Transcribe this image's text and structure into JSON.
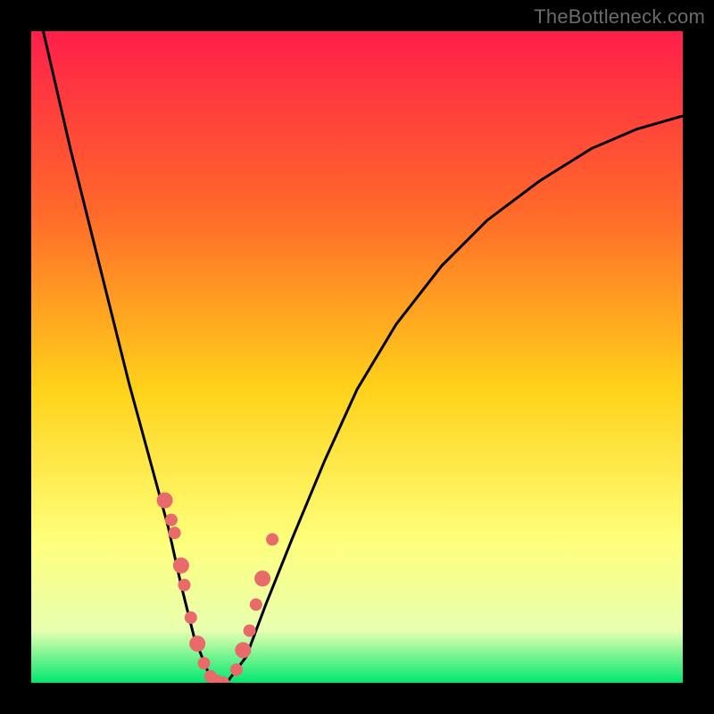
{
  "watermark": "TheBottleneck.com",
  "colors": {
    "frame": "#000000",
    "grad_top": "#ff1f4a",
    "grad_mid1": "#ff6a2a",
    "grad_mid2": "#ffd21a",
    "grad_mid3": "#ffff7a",
    "grad_mid4": "#e8ffb0",
    "grad_bottom": "#00e870",
    "curve": "#000000",
    "dots": "#e86a6a"
  },
  "chart_data": {
    "type": "line",
    "title": "",
    "xlabel": "",
    "ylabel": "",
    "xlim": [
      0,
      100
    ],
    "ylim": [
      0,
      100
    ],
    "series": [
      {
        "name": "bottleneck-curve",
        "x": [
          0,
          3,
          6,
          9,
          12,
          15,
          18,
          21,
          23,
          25,
          27,
          28,
          30,
          33,
          36,
          40,
          45,
          50,
          56,
          63,
          70,
          78,
          86,
          93,
          100
        ],
        "y": [
          108,
          95,
          82,
          70,
          58,
          46,
          35,
          24,
          15,
          7,
          2,
          0,
          0,
          4,
          12,
          22,
          34,
          45,
          55,
          64,
          71,
          77,
          82,
          85,
          87
        ]
      }
    ],
    "dots": {
      "name": "sample-points",
      "x": [
        20.5,
        21.5,
        22.0,
        23.0,
        23.5,
        24.5,
        25.5,
        26.5,
        27.5,
        28.5,
        29.5,
        31.5,
        32.5,
        33.5,
        34.5,
        35.5,
        37.0
      ],
      "y": [
        28,
        25,
        23,
        18,
        15,
        10,
        6,
        3,
        1,
        0,
        0,
        2,
        5,
        8,
        12,
        16,
        22
      ]
    }
  }
}
